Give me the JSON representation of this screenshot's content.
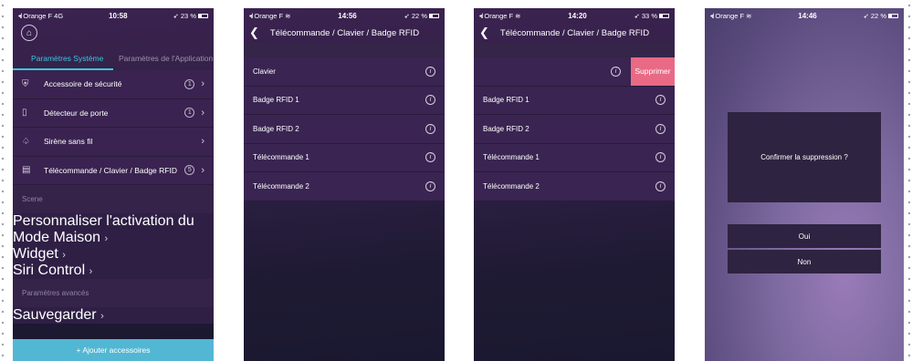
{
  "colors": {
    "accent": "#39c6da",
    "delete": "#e86a85",
    "add_bar": "#52b7d3"
  },
  "screen1": {
    "status": {
      "carrier": "Orange F",
      "network": "4G",
      "time": "10:58",
      "battery": "23 %"
    },
    "tabs": [
      "Paramètres Système",
      "Paramètres de l'Application"
    ],
    "devices": [
      {
        "icon": "shield-icon",
        "label": "Accessoire de sécurité",
        "count": "1"
      },
      {
        "icon": "door-sensor-icon",
        "label": "Détecteur de porte",
        "count": "1"
      },
      {
        "icon": "bell-icon",
        "label": "Sirène sans fil",
        "count": ""
      },
      {
        "icon": "keypad-icon",
        "label": "Télécommande / Clavier / Badge RFID",
        "count": "5"
      }
    ],
    "scene_header": "Scene",
    "scene_items": [
      "Personnaliser l'activation du Mode Maison",
      "Widget",
      "Siri Control"
    ],
    "advanced_header": "Paramètres avancés",
    "advanced_items": [
      "Sauvegarder"
    ],
    "add_button": "+  Ajouter accessoires"
  },
  "screen2": {
    "status": {
      "carrier": "Orange F",
      "time": "14:56",
      "battery": "22 %"
    },
    "title": "Télécommande / Clavier / Badge RFID",
    "items": [
      "Clavier",
      "Badge RFID 1",
      "Badge RFID 2",
      "Télécommande  1",
      "Télécommande 2"
    ]
  },
  "screen3": {
    "status": {
      "carrier": "Orange F",
      "time": "14:20",
      "battery": "33 %"
    },
    "title": "Télécommande / Clavier / Badge RFID",
    "delete_label": "Supprimer",
    "items": [
      "Badge RFID 1",
      "Badge RFID 2",
      "Télécommande  1",
      "Télécommande 2"
    ]
  },
  "screen4": {
    "status": {
      "carrier": "Orange F",
      "time": "14:46",
      "battery": "22 %"
    },
    "dialog_message": "Confirmer la suppression ?",
    "yes_label": "Oui",
    "no_label": "Non"
  }
}
